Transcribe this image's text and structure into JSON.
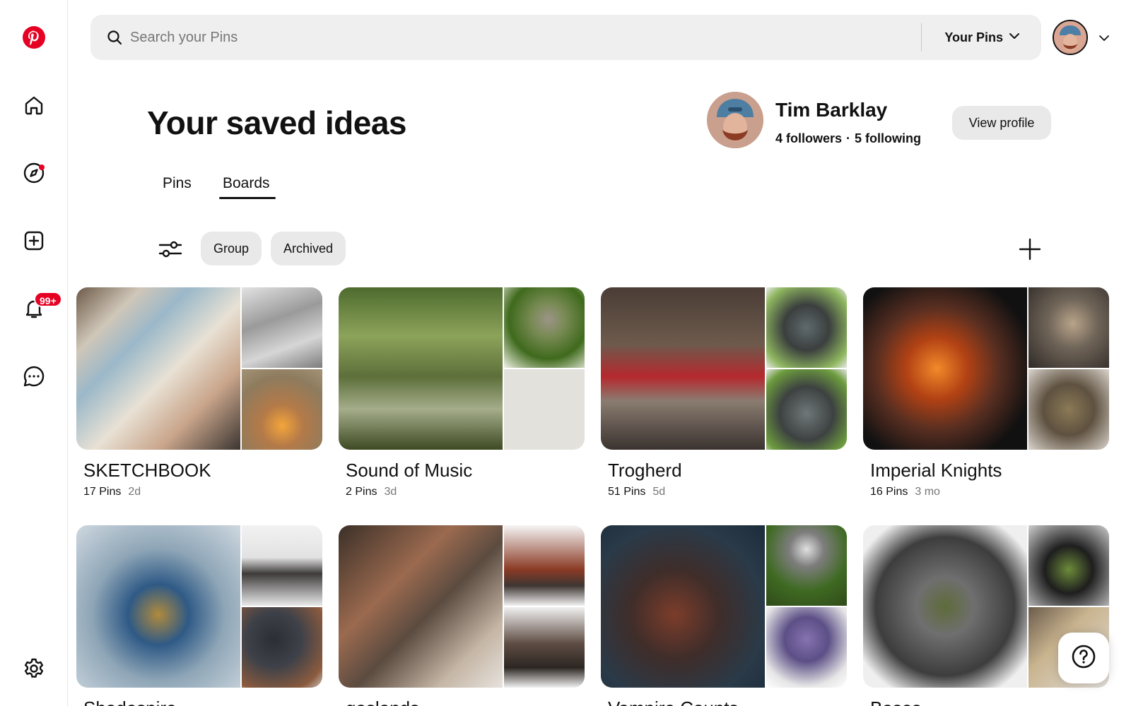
{
  "colors": {
    "brand": "#e60023",
    "chip_bg": "#e9e9e9",
    "search_bg": "#efefef"
  },
  "sidebar": {
    "items": [
      {
        "name": "pinterest-logo-icon"
      },
      {
        "name": "home-icon"
      },
      {
        "name": "explore-icon"
      },
      {
        "name": "create-icon"
      },
      {
        "name": "notifications-icon",
        "badge": "99+"
      },
      {
        "name": "messages-icon"
      },
      {
        "name": "settings-icon"
      }
    ]
  },
  "header": {
    "search_placeholder": "Search your Pins",
    "scope_label": "Your Pins"
  },
  "page": {
    "title": "Your saved ideas"
  },
  "profile": {
    "name": "Tim Barklay",
    "followers": "4 followers",
    "separator": "·",
    "following": "5 following",
    "view_profile_label": "View profile"
  },
  "tabs": [
    {
      "label": "Pins",
      "active": false
    },
    {
      "label": "Boards",
      "active": true
    }
  ],
  "filters": {
    "chips": [
      "Group",
      "Archived"
    ]
  },
  "boards": [
    {
      "title": "SKETCHBOOK",
      "pins": "17 Pins",
      "age": "2d"
    },
    {
      "title": "Sound of Music",
      "pins": "2 Pins",
      "age": "3d"
    },
    {
      "title": "Trogherd",
      "pins": "51 Pins",
      "age": "5d"
    },
    {
      "title": "Imperial Knights",
      "pins": "16 Pins",
      "age": "3 mo"
    },
    {
      "title": "Shadespire",
      "pins": "",
      "age": ""
    },
    {
      "title": "gaslands",
      "pins": "",
      "age": ""
    },
    {
      "title": "Vampire Counts",
      "pins": "",
      "age": ""
    },
    {
      "title": "Bases",
      "pins": "",
      "age": ""
    }
  ]
}
